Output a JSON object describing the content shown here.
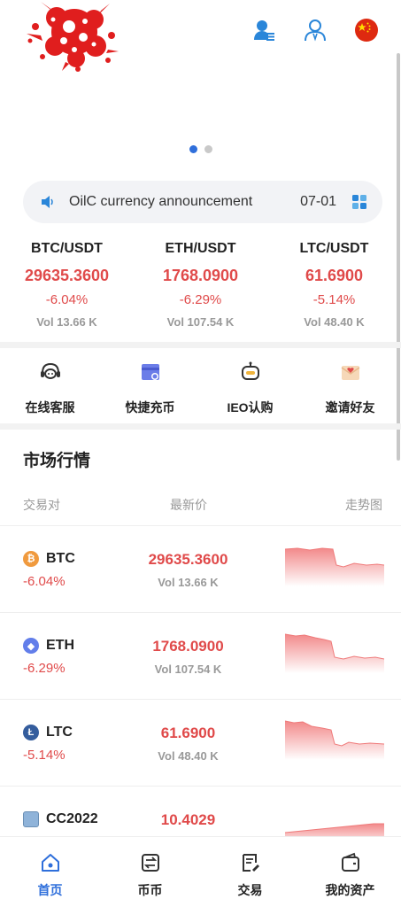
{
  "header": {
    "icons": [
      "service-list-icon",
      "user-icon",
      "china-flag-icon"
    ]
  },
  "banner": {
    "dots": 2,
    "active": 0
  },
  "notice": {
    "text": "OilC currency announcement",
    "date": "07-01"
  },
  "tickers": [
    {
      "pair": "BTC/USDT",
      "price": "29635.3600",
      "change": "-6.04%",
      "volume": "Vol 13.66 K"
    },
    {
      "pair": "ETH/USDT",
      "price": "1768.0900",
      "change": "-6.29%",
      "volume": "Vol 107.54 K"
    },
    {
      "pair": "LTC/USDT",
      "price": "61.6900",
      "change": "-5.14%",
      "volume": "Vol 48.40 K"
    }
  ],
  "quick_links": [
    {
      "label": "在线客服",
      "icon": "headset-icon"
    },
    {
      "label": "快捷充币",
      "icon": "deposit-card-icon"
    },
    {
      "label": "IEO认购",
      "icon": "robot-icon"
    },
    {
      "label": "邀请好友",
      "icon": "invite-envelope-icon"
    }
  ],
  "market": {
    "title": "市场行情",
    "columns": {
      "pair": "交易对",
      "price": "最新价",
      "trend": "走势图"
    },
    "rows": [
      {
        "name": "BTC",
        "change": "-6.04%",
        "price": "29635.3600",
        "volume": "Vol 13.66 K",
        "icon_color": "#f09a3e",
        "icon_glyph": "₿"
      },
      {
        "name": "ETH",
        "change": "-6.29%",
        "price": "1768.0900",
        "volume": "Vol 107.54 K",
        "icon_color": "#627eea",
        "icon_glyph": "◆"
      },
      {
        "name": "LTC",
        "change": "-5.14%",
        "price": "61.6900",
        "volume": "Vol 48.40 K",
        "icon_color": "#345d9d",
        "icon_glyph": "Ł"
      },
      {
        "name": "CC2022",
        "change": "",
        "price": "10.4029",
        "volume": "",
        "icon_color": "#8fb3d9",
        "icon_glyph": ""
      }
    ]
  },
  "tabs": [
    {
      "label": "首页",
      "icon": "home-icon",
      "active": true
    },
    {
      "label": "币币",
      "icon": "exchange-icon",
      "active": false
    },
    {
      "label": "交易",
      "icon": "trade-doc-icon",
      "active": false
    },
    {
      "label": "我的资产",
      "icon": "wallet-icon",
      "active": false
    }
  ],
  "colors": {
    "accent": "#2f6fdb",
    "down": "#e04a4a",
    "muted": "#999999"
  }
}
